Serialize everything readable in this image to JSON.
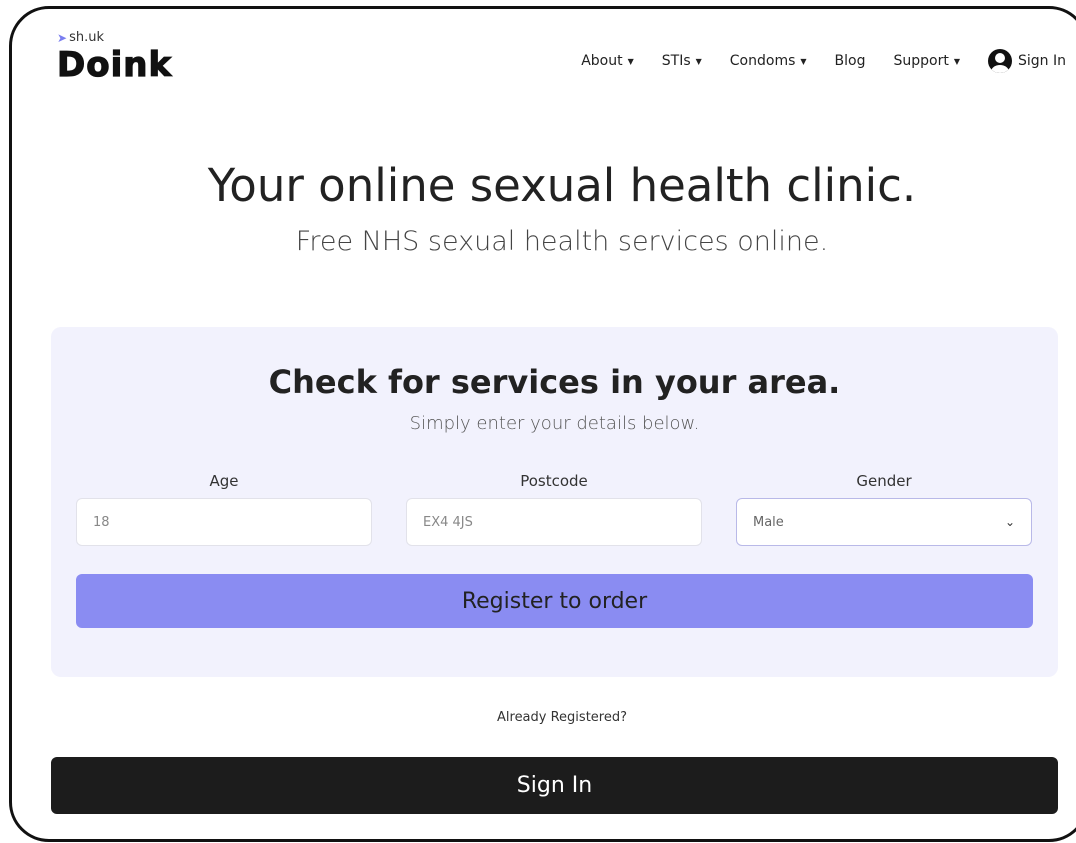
{
  "brand": {
    "prefix": "sh.uk",
    "name": "Doink"
  },
  "nav": {
    "items": [
      {
        "label": "About",
        "dropdown": true
      },
      {
        "label": "STIs",
        "dropdown": true
      },
      {
        "label": "Condoms",
        "dropdown": true
      },
      {
        "label": "Blog",
        "dropdown": false
      },
      {
        "label": "Support",
        "dropdown": true
      }
    ],
    "signin_label": "Sign In",
    "signin_icon": "user-circle-icon"
  },
  "hero": {
    "title": "Your online sexual health clinic.",
    "subtitle": "Free NHS sexual health services online."
  },
  "check": {
    "title": "Check for services in your area.",
    "subtitle": "Simply enter your details below.",
    "age_label": "Age",
    "age_placeholder": "18",
    "postcode_label": "Postcode",
    "postcode_placeholder": "EX4 4JS",
    "gender_label": "Gender",
    "gender_selected": "Male",
    "register_label": "Register to order"
  },
  "footer": {
    "already_registered": "Already Registered?",
    "signin_button": "Sign In"
  },
  "colors": {
    "accent": "#8a8cf2",
    "card_bg": "#f2f2fd",
    "dark_button": "#1c1c1c"
  }
}
